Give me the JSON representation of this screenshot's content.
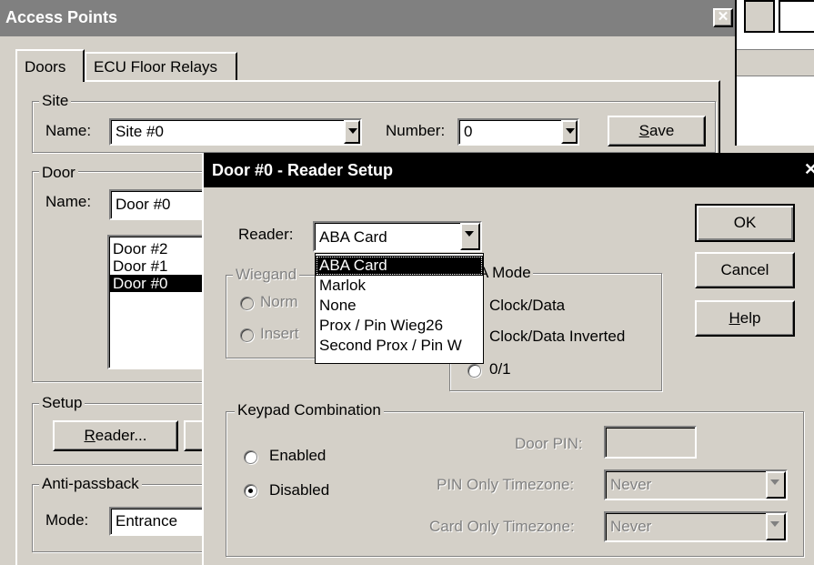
{
  "window": {
    "title": "Access Points"
  },
  "tabs": [
    "Doors",
    "ECU Floor Relays"
  ],
  "site": {
    "group_label": "Site",
    "name_label": "Name:",
    "name_value": "Site #0",
    "number_label": "Number:",
    "number_value": "0",
    "save_pre": "",
    "save_u": "S",
    "save_post": "ave"
  },
  "door": {
    "group_label": "Door",
    "name_label": "Name:",
    "name_value": "Door #0",
    "list": [
      "Door #2",
      "Door #1",
      "Door #0"
    ],
    "selected": "Door #0"
  },
  "setup": {
    "group_label": "Setup",
    "reader_u": "R",
    "reader_post": "eader..."
  },
  "antipassback": {
    "group_label": "Anti-passback",
    "mode_label": "Mode:",
    "mode_value": "Entrance"
  },
  "dialog": {
    "title": "Door #0 - Reader Setup",
    "reader_label": "Reader:",
    "reader_value": "ABA Card",
    "reader_options": [
      "ABA Card",
      "Marlok",
      "None",
      "Prox / Pin Wieg26",
      "Second Prox / Pin W"
    ],
    "reader_highlighted": "ABA Card",
    "ok": "OK",
    "cancel": "Cancel",
    "help_u": "H",
    "help_post": "elp",
    "wiegand": {
      "label": "Wiegand",
      "opt1": "Norm",
      "opt2": "Insert"
    },
    "aba_mode": {
      "label": "A Mode",
      "options": [
        "Clock/Data",
        "Clock/Data Inverted",
        "0/1"
      ]
    },
    "keypad": {
      "label": "Keypad Combination",
      "enabled": "Enabled",
      "disabled": "Disabled",
      "selected": "Disabled",
      "door_pin_label": "Door PIN:",
      "pin_only_label": "PIN Only Timezone:",
      "pin_only_value": "Never",
      "card_only_label": "Card Only Timezone:",
      "card_only_value": "Never"
    }
  }
}
